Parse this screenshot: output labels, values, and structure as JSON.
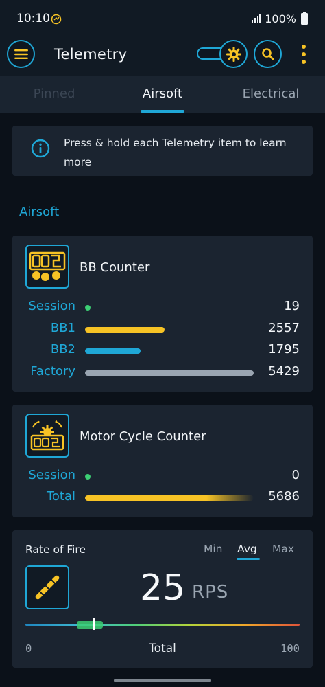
{
  "status_bar": {
    "time": "10:10",
    "battery": "100%"
  },
  "app_bar": {
    "title": "Telemetry"
  },
  "tabs": [
    {
      "label": "Pinned"
    },
    {
      "label": "Airsoft"
    },
    {
      "label": "Electrical"
    }
  ],
  "info": {
    "text": "Press & hold each Telemetry item to learn more"
  },
  "section": {
    "title": "Airsoft"
  },
  "bb_counter": {
    "title": "BB Counter",
    "rows": [
      {
        "label": "Session",
        "value": "19"
      },
      {
        "label": "BB1",
        "value": "2557",
        "fill": 0.47,
        "color": "#f7c325"
      },
      {
        "label": "BB2",
        "value": "1795",
        "fill": 0.33,
        "color": "#1fa7d6"
      },
      {
        "label": "Factory",
        "value": "5429",
        "fill": 1.0,
        "color": "#9aa5b1"
      }
    ]
  },
  "motor_counter": {
    "title": "Motor Cycle Counter",
    "rows": [
      {
        "label": "Session",
        "value": "0"
      },
      {
        "label": "Total",
        "value": "5686",
        "fill": 1.0,
        "color": "#f7c325"
      }
    ]
  },
  "rate_of_fire": {
    "title": "Rate of Fire",
    "options": [
      "Min",
      "Avg",
      "Max"
    ],
    "selected": "Avg",
    "value": "25",
    "unit": "RPS",
    "scale_min": "0",
    "scale_label": "Total",
    "scale_max": "100",
    "marker_value": 25
  },
  "colors": {
    "accent": "#1fa7d6",
    "yellow": "#f7c325",
    "green": "#3ccf74"
  }
}
